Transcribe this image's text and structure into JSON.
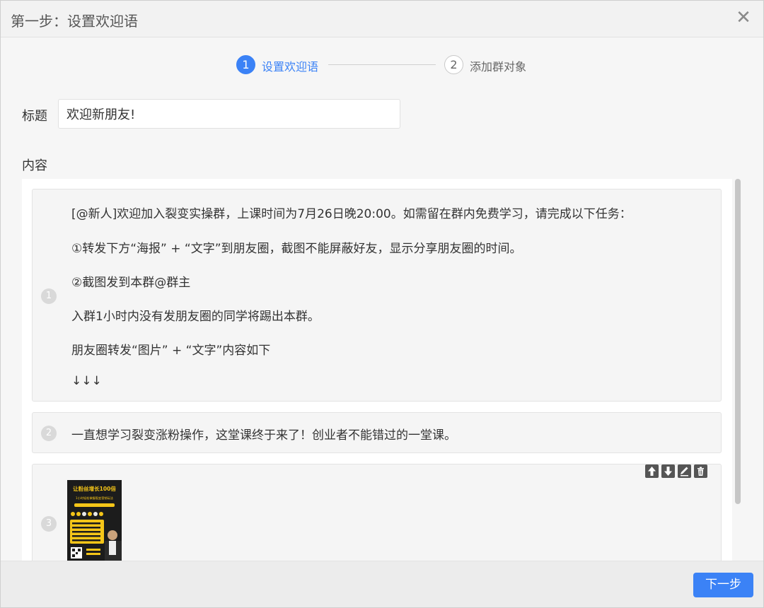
{
  "dialog": {
    "title": "第一步：设置欢迎语",
    "close_glyph": "✕"
  },
  "steps": [
    {
      "number": "1",
      "label": "设置欢迎语",
      "state": "active"
    },
    {
      "number": "2",
      "label": "添加群对象",
      "state": "pending"
    }
  ],
  "form": {
    "title_label": "标题",
    "title_value": "欢迎新朋友!",
    "content_label": "内容"
  },
  "messages": [
    {
      "index": "1",
      "lines": [
        "[@新人]欢迎加入裂变实操群，上课时间为7月26日晚20:00。如需留在群内免费学习，请完成以下任务：",
        "①转发下方“海报” + “文字”到朋友圈，截图不能屏蔽好友，显示分享朋友圈的时间。",
        "②截图发到本群@群主",
        "入群1小时内没有发朋友圈的同学将踢出本群。",
        "朋友圈转发“图片” + “文字”内容如下",
        "↓↓↓"
      ]
    },
    {
      "index": "2",
      "lines": [
        "一直想学习裂变涨粉操作，这堂课终于来了！创业者不能错过的一堂课。"
      ]
    },
    {
      "index": "3",
      "image": {
        "headline": "让粉丝增长100倍",
        "subline": "1小时轻松掌握裂变营销玩法"
      }
    }
  ],
  "card_tools": [
    "arrow-up-icon",
    "arrow-down-icon",
    "edit-icon",
    "trash-icon"
  ],
  "footer": {
    "next_label": "下一步"
  },
  "colors": {
    "accent": "#3b82f6",
    "poster_bg": "#1c1c1c",
    "poster_yellow": "#f5c518"
  }
}
